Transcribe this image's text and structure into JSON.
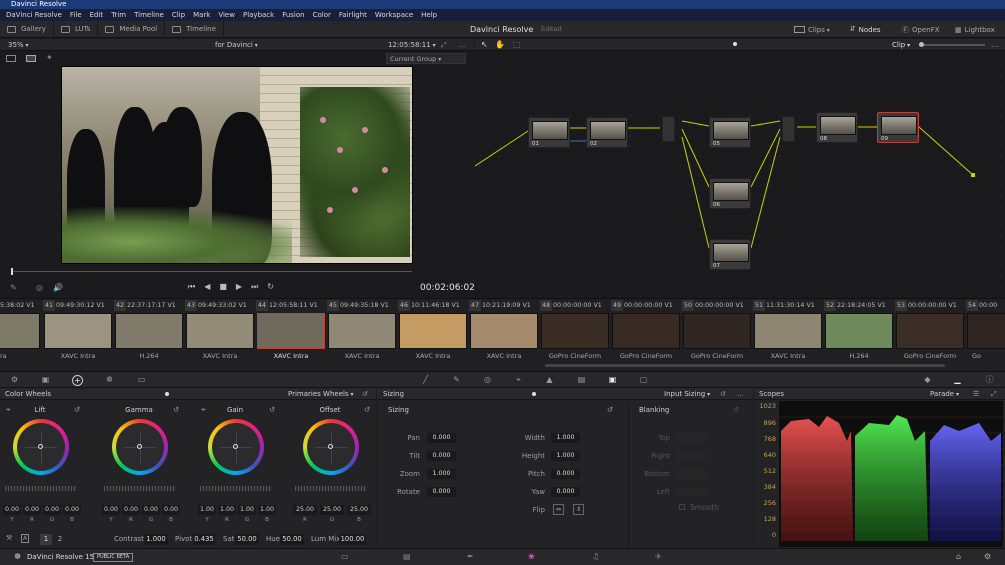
{
  "app": {
    "title": "Davinci Resolve",
    "project": "Davinci Resolve",
    "edited": "Edited",
    "version": "DaVinci Resolve 15",
    "beta": "PUBLIC BETA"
  },
  "menu": [
    "DaVinci Resolve",
    "File",
    "Edit",
    "Trim",
    "Timeline",
    "Clip",
    "Mark",
    "View",
    "Playback",
    "Fusion",
    "Color",
    "Fairlight",
    "Workspace",
    "Help"
  ],
  "toolbar": {
    "gallery": "Gallery",
    "luts": "LUTs",
    "media_pool": "Media Pool",
    "timeline": "Timeline",
    "clips": "Clips",
    "nodes": "Nodes",
    "openfx": "OpenFX",
    "lightbox": "Lightbox"
  },
  "viewer": {
    "zoom": "35%",
    "timeline_name": "for Davinci",
    "timecode_top": "12:05:58:11",
    "group": "Current Group",
    "timecode": "00:02:06:02"
  },
  "node_editor": {
    "mode": "Clip"
  },
  "nodes": [
    {
      "label": "01"
    },
    {
      "label": "02"
    },
    {
      "label": "05"
    },
    {
      "label": "06"
    },
    {
      "label": "07"
    },
    {
      "label": "08"
    },
    {
      "label": "09"
    }
  ],
  "clips": [
    {
      "num": "",
      "tc": "5:38:02",
      "track": "V1",
      "codec": "ra",
      "color": "#7d7a68"
    },
    {
      "num": "41",
      "tc": "09:49:30:12",
      "track": "V1",
      "codec": "XAVC Intra",
      "color": "#9b9482"
    },
    {
      "num": "42",
      "tc": "22:37:17:17",
      "track": "V1",
      "codec": "H.264",
      "color": "#807a6a"
    },
    {
      "num": "43",
      "tc": "09:49:33:02",
      "track": "V1",
      "codec": "XAVC Intra",
      "color": "#928b78"
    },
    {
      "num": "44",
      "tc": "12:05:58:11",
      "track": "V1",
      "codec": "XAVC Intra",
      "color": "#6f6a5c"
    },
    {
      "num": "45",
      "tc": "09:49:35:18",
      "track": "V1",
      "codec": "XAVC Intra",
      "color": "#8f8876"
    },
    {
      "num": "46",
      "tc": "10:11:46:18",
      "track": "V1",
      "codec": "XAVC Intra",
      "color": "#c49b62"
    },
    {
      "num": "47",
      "tc": "10:21:19:09",
      "track": "V1",
      "codec": "XAVC Intra",
      "color": "#a58a6c"
    },
    {
      "num": "48",
      "tc": "00:00:00:00",
      "track": "V1",
      "codec": "GoPro CineForm",
      "color": "#3a2d24"
    },
    {
      "num": "49",
      "tc": "00:00:00:00",
      "track": "V1",
      "codec": "GoPro CineForm",
      "color": "#362a22"
    },
    {
      "num": "50",
      "tc": "00:00:00:00",
      "track": "V1",
      "codec": "GoPro CineForm",
      "color": "#2f2621"
    },
    {
      "num": "51",
      "tc": "11:31:30:14",
      "track": "V1",
      "codec": "XAVC Intra",
      "color": "#8e8672"
    },
    {
      "num": "52",
      "tc": "22:18:24:05",
      "track": "V1",
      "codec": "H.264",
      "color": "#6f8a5d"
    },
    {
      "num": "53",
      "tc": "00:00:00:00",
      "track": "V1",
      "codec": "GoPro CineForm",
      "color": "#3a2e26"
    },
    {
      "num": "54",
      "tc": "00:00",
      "track": "",
      "codec": "Go",
      "color": "#2f2520"
    }
  ],
  "color_wheels": {
    "title": "Color Wheels",
    "mode": "Primaries Wheels",
    "wheels": [
      {
        "name": "Lift",
        "values": [
          "0.00",
          "0.00",
          "0.00",
          "0.00"
        ]
      },
      {
        "name": "Gamma",
        "values": [
          "0.00",
          "0.00",
          "0.00",
          "0.00"
        ]
      },
      {
        "name": "Gain",
        "values": [
          "1.00",
          "1.00",
          "1.00",
          "1.00"
        ]
      },
      {
        "name": "Offset",
        "values": [
          "25.00",
          "25.00",
          "25.00"
        ]
      }
    ],
    "channels4": [
      "Y",
      "R",
      "G",
      "B"
    ],
    "channels3": [
      "R",
      "G",
      "B"
    ],
    "page1": "1",
    "page2": "2",
    "contrast_label": "Contrast",
    "contrast": "1.000",
    "pivot_label": "Pivot",
    "pivot": "0.435",
    "sat_label": "Sat",
    "sat": "50.00",
    "hue_label": "Hue",
    "hue": "50.00",
    "lummix_label": "Lum Mix",
    "lummix": "100.00"
  },
  "sizing": {
    "title": "Sizing",
    "mode": "Input Sizing",
    "section": "Sizing",
    "blanking": "Blanking",
    "left": [
      {
        "label": "Pan",
        "value": "0.000"
      },
      {
        "label": "Tilt",
        "value": "0.000"
      },
      {
        "label": "Zoom",
        "value": "1.000"
      },
      {
        "label": "Rotate",
        "value": "0.000"
      }
    ],
    "right": [
      {
        "label": "Width",
        "value": "1.000"
      },
      {
        "label": "Height",
        "value": "1.000"
      },
      {
        "label": "Pitch",
        "value": "0.000"
      },
      {
        "label": "Yaw",
        "value": "0.000"
      }
    ],
    "flip": "Flip",
    "blank": [
      "Top",
      "Right",
      "Bottom",
      "Left"
    ],
    "smooth": "Smooth"
  },
  "scopes": {
    "title": "Scopes",
    "mode": "Parade",
    "axis": [
      "1023",
      "896",
      "768",
      "640",
      "512",
      "384",
      "256",
      "128",
      "0"
    ]
  }
}
